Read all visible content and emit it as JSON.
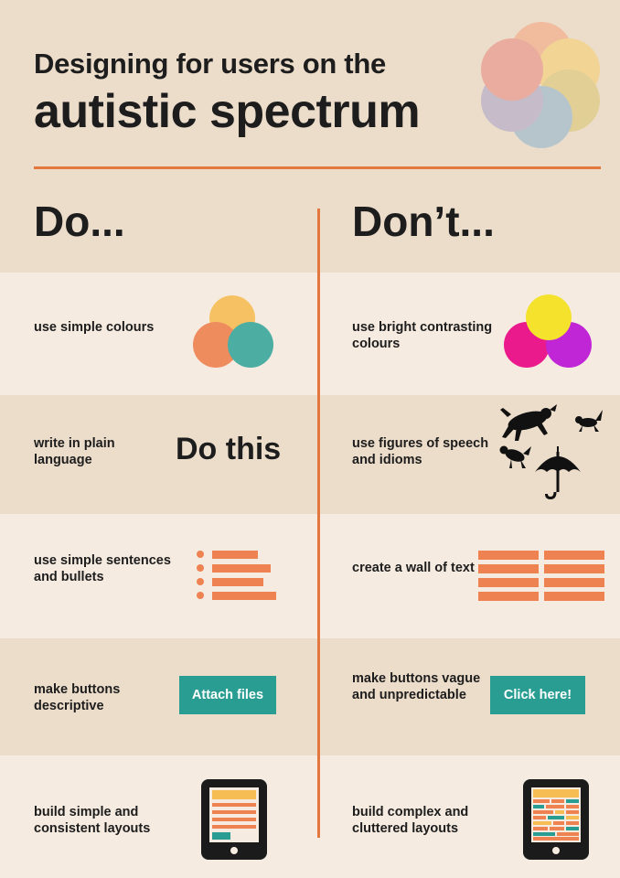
{
  "header": {
    "title_line1": "Designing for users on the",
    "title_line2": "autistic spectrum"
  },
  "columns": {
    "do": "Do...",
    "dont": "Don’t..."
  },
  "rows": [
    {
      "do": "use simple colours",
      "dont": "use bright contrasting colours"
    },
    {
      "do": "write in plain language",
      "dont": "use figures of speech and idioms"
    },
    {
      "do": "use simple sentences and bullets",
      "dont": "create a wall of text"
    },
    {
      "do": "make buttons descriptive",
      "dont": "make buttons vague and unpredictable"
    },
    {
      "do": "build simple and consistent layouts",
      "dont": "build complex and cluttered layouts"
    }
  ],
  "examples": {
    "plain_text": "Do this",
    "attach_button": "Attach files",
    "click_button": "Click here!"
  },
  "colors": {
    "background": "#ecdcca",
    "row_light": "#f6ebe0",
    "accent_orange": "#e3773d",
    "teal": "#2a9d93",
    "simple_yellow": "#f7bd55",
    "simple_orange": "#ee8250",
    "simple_teal": "#3aa89c",
    "bright_yellow": "#f4e22c",
    "bright_magenta": "#ea1a8c",
    "bright_purple": "#c026d6"
  },
  "icons": [
    "overlapping-circles-logo",
    "simple-colour-circles",
    "bright-colour-circles",
    "animals-and-umbrella-icon",
    "bullet-list-icon",
    "wall-of-text-icon",
    "simple-tablet-icon",
    "cluttered-tablet-icon"
  ]
}
